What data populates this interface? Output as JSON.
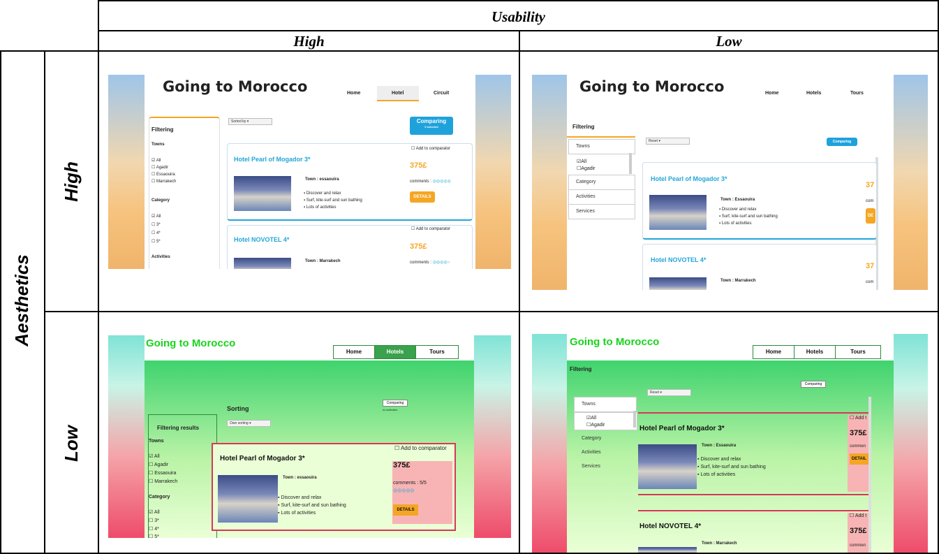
{
  "table": {
    "usability_header": "Usability",
    "high_col": "High",
    "low_col": "Low",
    "aesthetics_label": "Aesthetics",
    "high_row": "High",
    "low_row": "Low"
  },
  "screens": {
    "hh": {
      "logo": "Going to Morocco",
      "nav": [
        "Home",
        "Hotel",
        "Circuit"
      ],
      "sort": "Sorted by",
      "compare_btn": "Comparing",
      "compare_sub": "0 selected",
      "filtering": "Filtering",
      "towns_title": "Towns",
      "towns": [
        "All",
        "Agadir",
        "Essaouira",
        "Marrakech"
      ],
      "category_title": "Category",
      "categories": [
        "All",
        "3*",
        "4*",
        "5*"
      ],
      "activities_title": "Activities",
      "hotel1": "Hotel Pearl of Mogador 3*",
      "hotel2": "Hotel NOVOTEL 4*",
      "add": "Add to comparator",
      "price": "375£",
      "town1": "Town : essaouira",
      "town2": "Town : Marrakech",
      "comments": "comments :",
      "rating1": "◎◎◎◎◎",
      "rating2": "◎◎◎◎○",
      "bullets": [
        "Discover and relax",
        "Surf, kite-surf and sun bathing",
        "Lots of activities"
      ],
      "details": "DETAILS"
    },
    "hl": {
      "logo": "Going to Morocco",
      "nav": [
        "Home",
        "Hotels",
        "Tours"
      ],
      "filtering": "Filtering",
      "reset": "Reset",
      "compare_btn": "Comparing",
      "acc": [
        "Towns",
        "Category",
        "Activities",
        "Services"
      ],
      "towns": [
        "All",
        "Agadir"
      ],
      "hotel1": "Hotel Pearl of Mogador 3*",
      "hotel2": "Hotel NOVOTEL 4*",
      "town1": "Town : Essaouira",
      "town2": "Town : Marrakech",
      "price": "37",
      "comments": "com",
      "details": "DE",
      "bullets": [
        "Discover and relax",
        "Surf, kite-surf and sun bathing",
        "Lots of activities"
      ]
    },
    "lh": {
      "logo": "Going to Morocco",
      "nav": [
        "Home",
        "Hotels",
        "Tours"
      ],
      "sorting": "Sorting",
      "sort_select": "Own sorting",
      "compare_btn": "Comparing",
      "no_selection": "no selection",
      "filter_title": "Filtering results",
      "towns_title": "Towns",
      "towns": [
        "All",
        "Agadir",
        "Essaouira",
        "Marrakech"
      ],
      "category_title": "Category",
      "categories": [
        "All",
        "3*",
        "4*",
        "5*"
      ],
      "hotel1": "Hotel Pearl of Mogador 3*",
      "add": "Add to comparator",
      "price": "375£",
      "comments": "comments : 5/5",
      "rating": "◎◎◎◎◎",
      "town1": "Town : essaouira",
      "bullets": [
        "Discover and relax",
        "Surf, kite-surf and sun bathing",
        "Lots of activities"
      ],
      "details": "DETAILS"
    },
    "ll": {
      "logo": "Going to Morocco",
      "nav": [
        "Home",
        "Hotels",
        "Tours"
      ],
      "filtering": "Filtering",
      "reset": "Reset",
      "compare_btn": "Comparing",
      "acc": [
        "Towns",
        "Category",
        "Activities",
        "Services"
      ],
      "towns": [
        "All",
        "Agadir"
      ],
      "hotel1": "Hotel Pearl of Mogador 3*",
      "hotel2": "Hotel NOVOTEL 4*",
      "town1": "Town : Essaouira",
      "town2": "Town : Marrakech",
      "add": "Add t",
      "price": "375£",
      "comments": "commen",
      "details": "DETAIL",
      "bullets": [
        "Discover and relax",
        "Surf, kite-surf and sun bathing",
        "Lots of activities"
      ]
    }
  }
}
